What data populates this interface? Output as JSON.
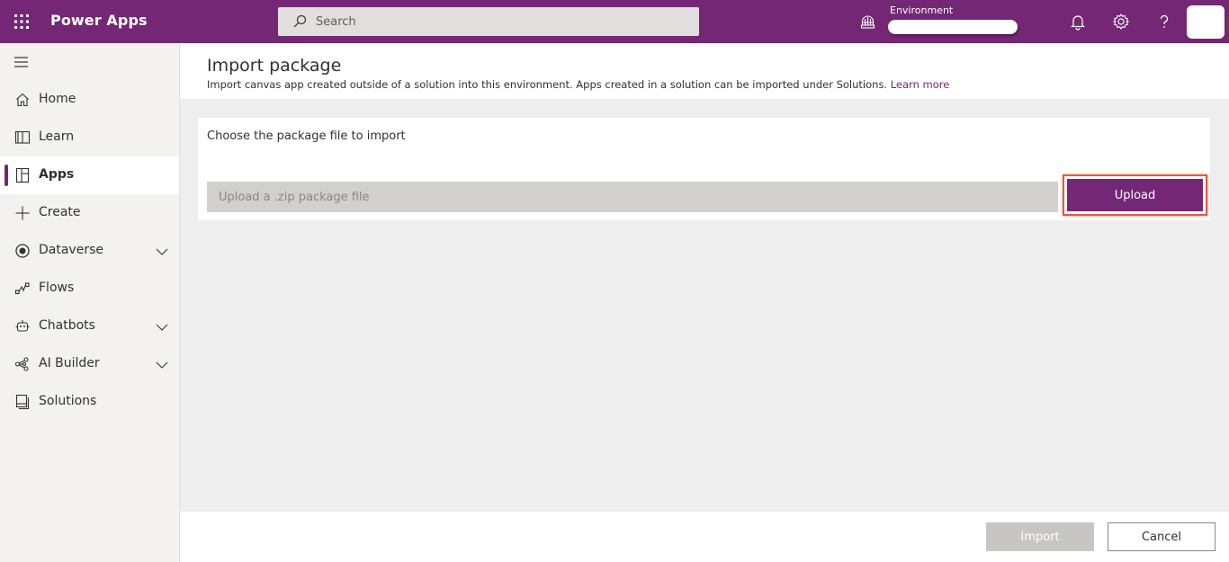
{
  "topbar": {
    "app_title": "Power Apps",
    "waffle_icon": "waffle-icon",
    "search": {
      "placeholder": "Search",
      "icon": "search-icon"
    },
    "environment": {
      "label": "Environment",
      "icon": "environment-icon"
    },
    "icons": [
      "bell-icon",
      "gear-icon",
      "help-icon"
    ],
    "brand_color": "#742774"
  },
  "sidebar": {
    "menu_icon": "hamburger-icon",
    "items": [
      {
        "label": "Home",
        "icon": "home-icon",
        "selected": false,
        "expandable": false
      },
      {
        "label": "Learn",
        "icon": "book-icon",
        "selected": false,
        "expandable": false
      },
      {
        "label": "Apps",
        "icon": "apps-icon",
        "selected": true,
        "expandable": false
      },
      {
        "label": "Create",
        "icon": "plus-icon",
        "selected": false,
        "expandable": false
      },
      {
        "label": "Dataverse",
        "icon": "dataverse-icon",
        "selected": false,
        "expandable": true
      },
      {
        "label": "Flows",
        "icon": "flow-icon",
        "selected": false,
        "expandable": false
      },
      {
        "label": "Chatbots",
        "icon": "bot-icon",
        "selected": false,
        "expandable": true
      },
      {
        "label": "AI Builder",
        "icon": "ai-builder-icon",
        "selected": false,
        "expandable": true
      },
      {
        "label": "Solutions",
        "icon": "solutions-icon",
        "selected": false,
        "expandable": false
      }
    ]
  },
  "main": {
    "title": "Import package",
    "description": "Import canvas app created outside of a solution into this environment. Apps created in a solution can be imported under Solutions.",
    "learn_more": "Learn more",
    "card": {
      "label": "Choose the package file to import",
      "file_placeholder": "Upload a .zip package file",
      "upload_label": "Upload"
    },
    "footer": {
      "import_label": "Import",
      "cancel_label": "Cancel"
    }
  }
}
